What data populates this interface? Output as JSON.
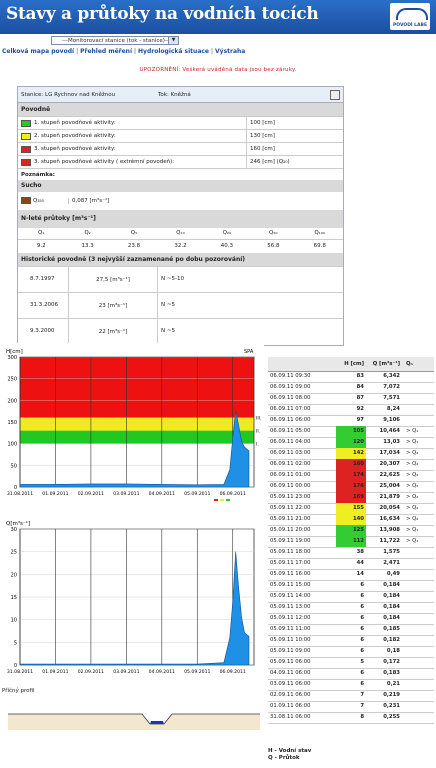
{
  "header": {
    "title": "Stavy a průtoky na vodních tocích",
    "logo_text": "POVODÍ LABE"
  },
  "station_select": {
    "value": "---Monitorovací stanice (tok - stanice)---"
  },
  "nav": [
    "Celková mapa povodí",
    "Přehled měření",
    "Hydrologická situace",
    "Výstraha"
  ],
  "nav_sep": "|",
  "warning": "UPOZORNĚNÍ: Veškerá uváděná data jsou bez záruky.",
  "station": {
    "label": "Stanice: LG Rychnov nad Kněžnou",
    "tok": "Tok: Kněžná"
  },
  "povodne": {
    "heading": "Povodně",
    "rows": [
      {
        "label": "1. stupeň povodňové aktivity:",
        "value": "100 [cm]",
        "color": "#22cc22"
      },
      {
        "label": "2. stupeň povodňové aktivity:",
        "value": "130 [cm]",
        "color": "#eeee22"
      },
      {
        "label": "3. stupeň povodňové aktivity:",
        "value": "160 [cm]",
        "color": "#dd2222"
      },
      {
        "label": "3. stupeň povodňové aktivity ( extrémní povodeň):",
        "value": "246 [cm] (Q₂₀)",
        "color": "#dd2222"
      }
    ],
    "poznamka": "Poznámka:"
  },
  "sucho": {
    "heading": "Sucho",
    "label": "Q₃₅₅",
    "value": "0,087 [m³s⁻¹]",
    "color": "#8b4513"
  },
  "nlete": {
    "heading": "N-leté průtoky [m³s⁻¹]",
    "headers": [
      "Q₁",
      "Q₂",
      "Q₅",
      "Q₁₀",
      "Q₂₀",
      "Q₅₀",
      "Q₁₀₀"
    ],
    "values": [
      "9.2",
      "13.3",
      "23.8",
      "32.2",
      "40.3",
      "56.8",
      "69.8"
    ]
  },
  "historicke": {
    "heading": "Historické povodně (3 nejvyšší zaznamenané po dobu pozorování)",
    "rows": [
      {
        "date": "8.7.1997",
        "q": "27,5 [m³s⁻¹]",
        "n": "N ~5-10"
      },
      {
        "date": "31.3.2006",
        "q": "23 [m³s⁻¹]",
        "n": "N ~5"
      },
      {
        "date": "9.3.2000",
        "q": "22 [m³s⁻¹]",
        "n": "N ~5"
      }
    ]
  },
  "chart_h": {
    "ylabel": "H[cm]",
    "spa": "SPA",
    "spa_levels": [
      "III.",
      "II.",
      "I."
    ],
    "yticks": [
      "300",
      "250",
      "200",
      "150",
      "100",
      "50",
      "0"
    ]
  },
  "chart_q": {
    "ylabel": "Q[m³s⁻¹]",
    "yticks": [
      "30",
      "25",
      "20",
      "15",
      "10",
      "5",
      "0"
    ]
  },
  "xdates": [
    "31.08.2011",
    "01.09.2011",
    "02.09.2011",
    "03.09.2011",
    "04.09.2011",
    "05.09.2011",
    "06.09.2011"
  ],
  "profile": {
    "label": "Příčný profil"
  },
  "chart_data": [
    {
      "type": "area",
      "title": "",
      "ylabel": "H[cm]",
      "ylim": [
        0,
        300
      ],
      "x": [
        "31.08.2011",
        "01.09.2011",
        "02.09.2011",
        "03.09.2011",
        "04.09.2011",
        "05.09.2011",
        "05.09.2011 18:00",
        "05.09.2011 22:00",
        "06.09.2011 00:00",
        "06.09.2011 02:00",
        "06.09.2011 04:00",
        "06.09.2011 06:00",
        "06.09.2011 08:00",
        "06.09.2011 11:00"
      ],
      "values": [
        6,
        6,
        7,
        7,
        6,
        5,
        6,
        40,
        112,
        176,
        142,
        105,
        92,
        83
      ],
      "bands": [
        {
          "from": 160,
          "to": 300,
          "color": "#ee1111"
        },
        {
          "from": 130,
          "to": 160,
          "color": "#f2ea1a"
        },
        {
          "from": 100,
          "to": 130,
          "color": "#22c822"
        }
      ]
    },
    {
      "type": "area",
      "title": "",
      "ylabel": "Q[m³s⁻¹]",
      "ylim": [
        0,
        30
      ],
      "x": [
        "31.08.2011",
        "01.09.2011",
        "02.09.2011",
        "03.09.2011",
        "04.09.2011",
        "05.09.2011",
        "05.09.2011 18:00",
        "05.09.2011 22:00",
        "06.09.2011 00:00",
        "06.09.2011 02:00",
        "06.09.2011 04:00",
        "06.09.2011 06:00",
        "06.09.2011 08:00",
        "06.09.2011 11:00"
      ],
      "values": [
        0.2,
        0.2,
        0.2,
        0.2,
        0.2,
        0.2,
        0.5,
        6,
        13.9,
        25.0,
        17.0,
        10.5,
        7.1,
        6.3
      ]
    }
  ],
  "table": {
    "headers": [
      "",
      "H [cm]",
      "Q [m³s⁻¹]",
      "Qₙ"
    ],
    "rows": [
      {
        "t": "06.09.11 09:30",
        "h": "83",
        "q": "6,342",
        "qn": "",
        "c": ""
      },
      {
        "t": "06.09.11 09:00",
        "h": "84",
        "q": "7,072",
        "qn": "",
        "c": ""
      },
      {
        "t": "06.09.11 08:00",
        "h": "87",
        "q": "7,571",
        "qn": "",
        "c": ""
      },
      {
        "t": "06.09.11 07:00",
        "h": "92",
        "q": "8,24",
        "qn": "",
        "c": ""
      },
      {
        "t": "06.09.11 06:00",
        "h": "97",
        "q": "9,106",
        "qn": "",
        "c": ""
      },
      {
        "t": "06.09.11 05:00",
        "h": "105",
        "q": "10,464",
        "qn": "> Q₁",
        "c": "#33cc33"
      },
      {
        "t": "06.09.11 04:00",
        "h": "120",
        "q": "13,03",
        "qn": "> Q₁",
        "c": "#33cc33"
      },
      {
        "t": "06.09.11 03:00",
        "h": "142",
        "q": "17,034",
        "qn": "> Q₂",
        "c": "#eeee22"
      },
      {
        "t": "06.09.11 02:00",
        "h": "160",
        "q": "20,307",
        "qn": "> Q₂",
        "c": "#dd2222"
      },
      {
        "t": "06.09.11 01:00",
        "h": "174",
        "q": "22,625",
        "qn": "> Q₂",
        "c": "#dd2222"
      },
      {
        "t": "06.09.11 00:00",
        "h": "176",
        "q": "25,004",
        "qn": "> Q₅",
        "c": "#dd2222"
      },
      {
        "t": "05.09.11 23:00",
        "h": "169",
        "q": "21,879",
        "qn": "> Q₂",
        "c": "#dd2222"
      },
      {
        "t": "05.09.11 22:00",
        "h": "155",
        "q": "20,054",
        "qn": "> Q₂",
        "c": "#eeee22"
      },
      {
        "t": "05.09.11 21:00",
        "h": "140",
        "q": "16,634",
        "qn": "> Q₂",
        "c": "#eeee22"
      },
      {
        "t": "05.09.11 20:00",
        "h": "125",
        "q": "13,908",
        "qn": "> Q₁",
        "c": "#33cc33"
      },
      {
        "t": "05.09.11 19:00",
        "h": "112",
        "q": "11,722",
        "qn": "> Q₁",
        "c": "#33cc33"
      },
      {
        "t": "05.09.11 18:00",
        "h": "38",
        "q": "1,575",
        "qn": "",
        "c": ""
      },
      {
        "t": "05.09.11 17:00",
        "h": "44",
        "q": "2,471",
        "qn": "",
        "c": ""
      },
      {
        "t": "05.09.11 16:00",
        "h": "14",
        "q": "0,49",
        "qn": "",
        "c": ""
      },
      {
        "t": "05.09.11 15:00",
        "h": "6",
        "q": "0,184",
        "qn": "",
        "c": ""
      },
      {
        "t": "05.09.11 14:00",
        "h": "6",
        "q": "0,184",
        "qn": "",
        "c": ""
      },
      {
        "t": "05.09.11 13:00",
        "h": "6",
        "q": "0,184",
        "qn": "",
        "c": ""
      },
      {
        "t": "05.09.11 12:00",
        "h": "6",
        "q": "0,184",
        "qn": "",
        "c": ""
      },
      {
        "t": "05.09.11 11:00",
        "h": "6",
        "q": "0,185",
        "qn": "",
        "c": ""
      },
      {
        "t": "05.09.11 10:00",
        "h": "6",
        "q": "0,182",
        "qn": "",
        "c": ""
      },
      {
        "t": "05.09.11 09:00",
        "h": "6",
        "q": "0,18",
        "qn": "",
        "c": ""
      },
      {
        "t": "05.09.11 06:00",
        "h": "5",
        "q": "0,172",
        "qn": "",
        "c": ""
      },
      {
        "t": "04.09.11 06:00",
        "h": "6",
        "q": "0,183",
        "qn": "",
        "c": ""
      },
      {
        "t": "03.09.11 06:00",
        "h": "6",
        "q": "0,21",
        "qn": "",
        "c": ""
      },
      {
        "t": "02.09.11 06:00",
        "h": "7",
        "q": "0,219",
        "qn": "",
        "c": ""
      },
      {
        "t": "01.09.11 06:00",
        "h": "7",
        "q": "0,231",
        "qn": "",
        "c": ""
      },
      {
        "t": "31.08.11 06:00",
        "h": "8",
        "q": "0,255",
        "qn": "",
        "c": ""
      }
    ]
  },
  "legend": {
    "h": "H - Vodní stav",
    "q": "Q - Průtok"
  }
}
